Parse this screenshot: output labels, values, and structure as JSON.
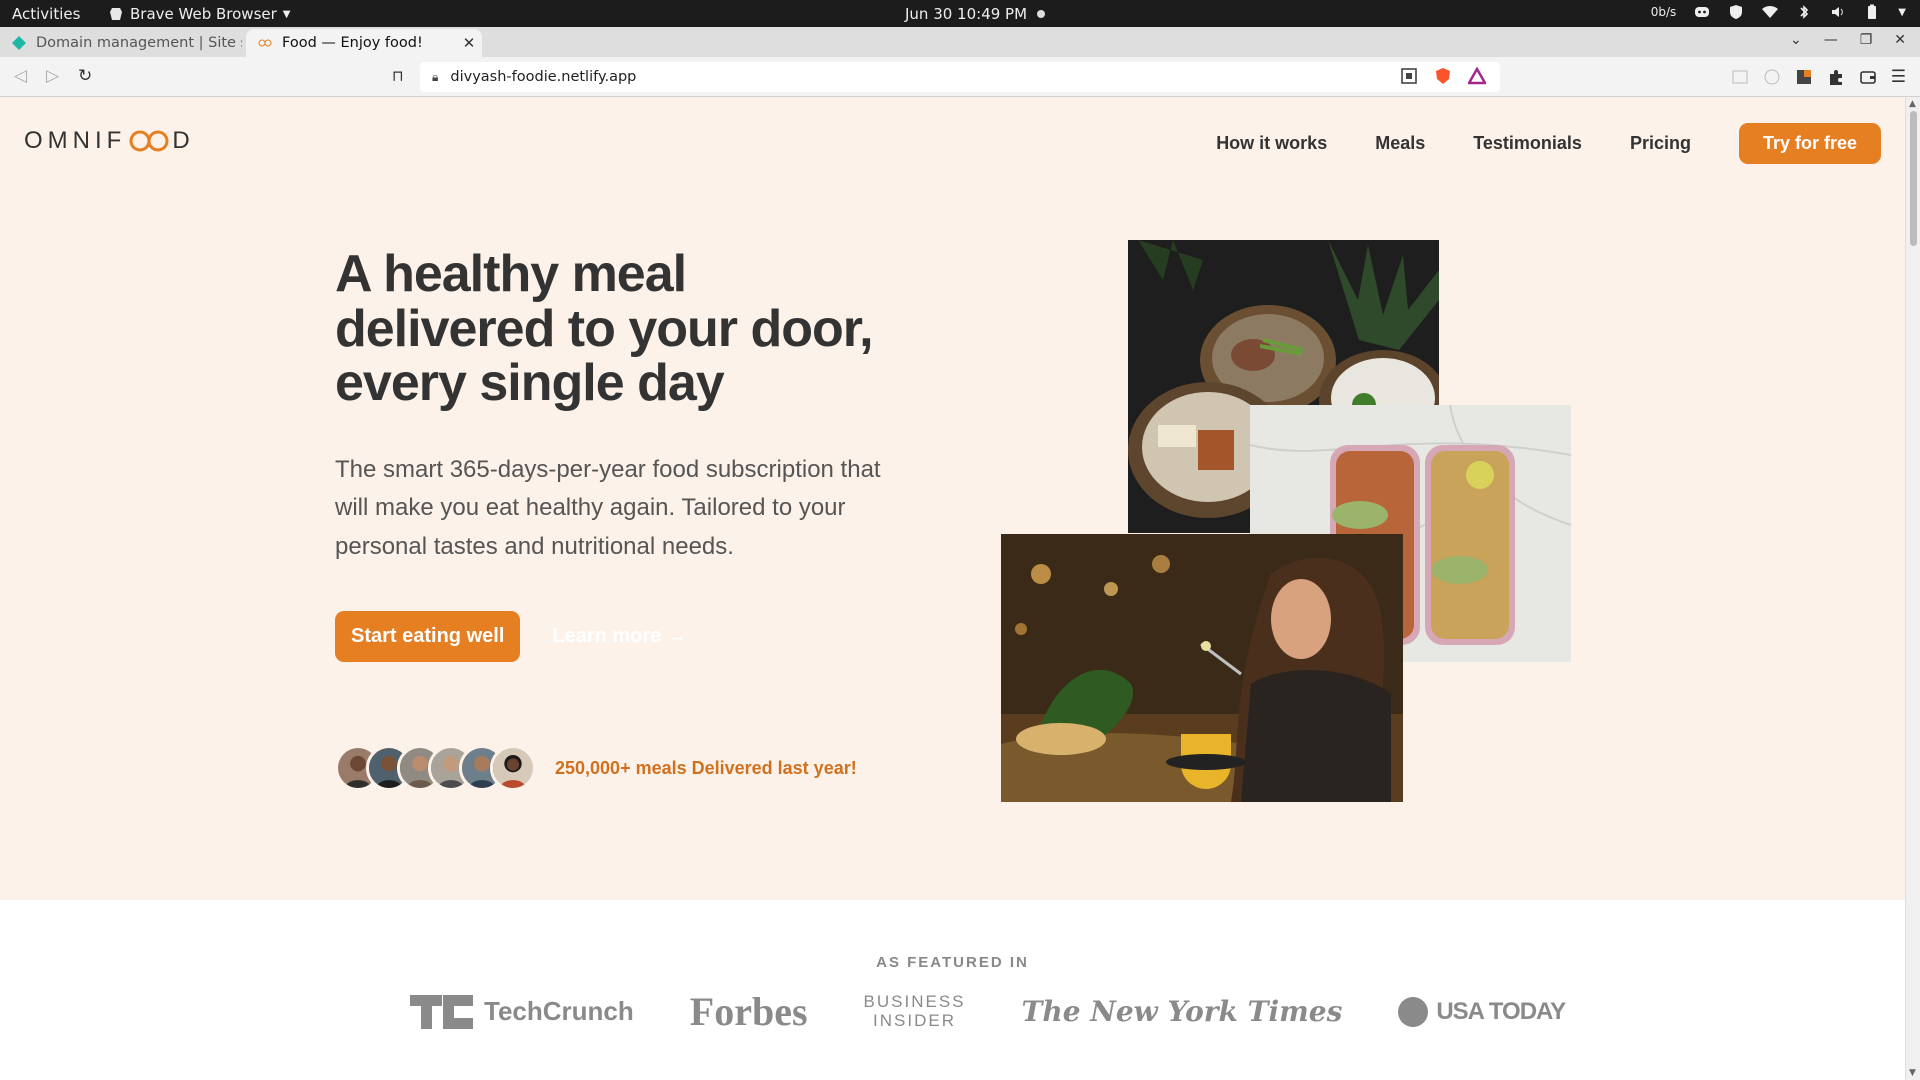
{
  "system_bar": {
    "activities": "Activities",
    "app_name": "Brave Web Browser",
    "clock": "Jun 30  10:49 PM",
    "net_speed": "0b/s"
  },
  "tabs": [
    {
      "label": "Domain management | Site se",
      "active": false
    },
    {
      "label": "Food — Enjoy food!",
      "active": true
    }
  ],
  "browser": {
    "url": "divyash-foodie.netlify.app"
  },
  "site": {
    "logo": {
      "before": "OMNIF",
      "after": "D"
    },
    "nav": {
      "how": "How it works",
      "meals": "Meals",
      "testimonials": "Testimonials",
      "pricing": "Pricing",
      "cta": "Try for free"
    },
    "hero": {
      "title": "A healthy meal delivered to your door, every single day",
      "description": "The smart 365-days-per-year food subscription that will make you eat healthy again. Tailored to your personal tastes and nutritional needs.",
      "primary_btn": "Start eating well",
      "secondary_btn": "Learn more →",
      "delivered": "250,000+ meals Delivered last year!"
    },
    "featured": {
      "title": "AS FEATURED IN",
      "logos": {
        "techcrunch": "TechCrunch",
        "forbes": "Forbes",
        "bi_line1": "BUSINESS",
        "bi_line2": "INSIDER",
        "nyt": "The New York Times",
        "usa": "USA TODAY"
      }
    }
  },
  "colors": {
    "accent": "#e67e22",
    "hero_bg": "#fdf2e9",
    "text": "#333333"
  }
}
